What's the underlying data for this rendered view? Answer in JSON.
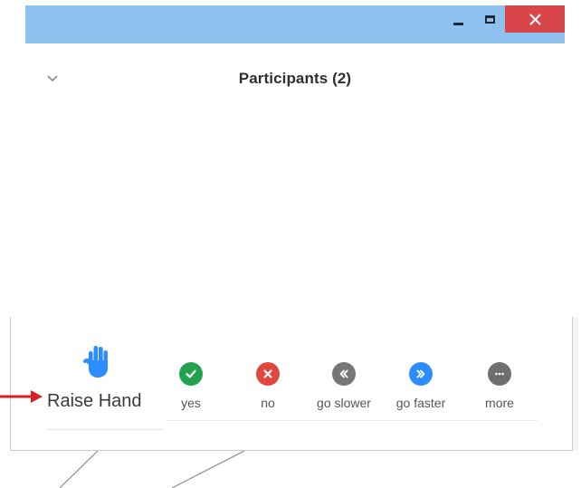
{
  "panel": {
    "title": "Participants (2)"
  },
  "feedback": {
    "raise_hand_label": "Raise Hand",
    "items": [
      {
        "label": "yes",
        "icon": "check-icon",
        "color": "#23a24d"
      },
      {
        "label": "no",
        "icon": "close-icon",
        "color": "#e0473e"
      },
      {
        "label": "go slower",
        "icon": "rewind-icon",
        "color": "#767676"
      },
      {
        "label": "go faster",
        "icon": "fast-forward-icon",
        "color": "#2d8cff"
      },
      {
        "label": "more",
        "icon": "more-dots-icon",
        "color": "#6f6f6f"
      }
    ]
  },
  "colors": {
    "titlebar": "#8ec1ed",
    "close_button": "#d8454a",
    "hand_icon": "#2d8cff",
    "annotation_arrow": "#d81f26"
  }
}
